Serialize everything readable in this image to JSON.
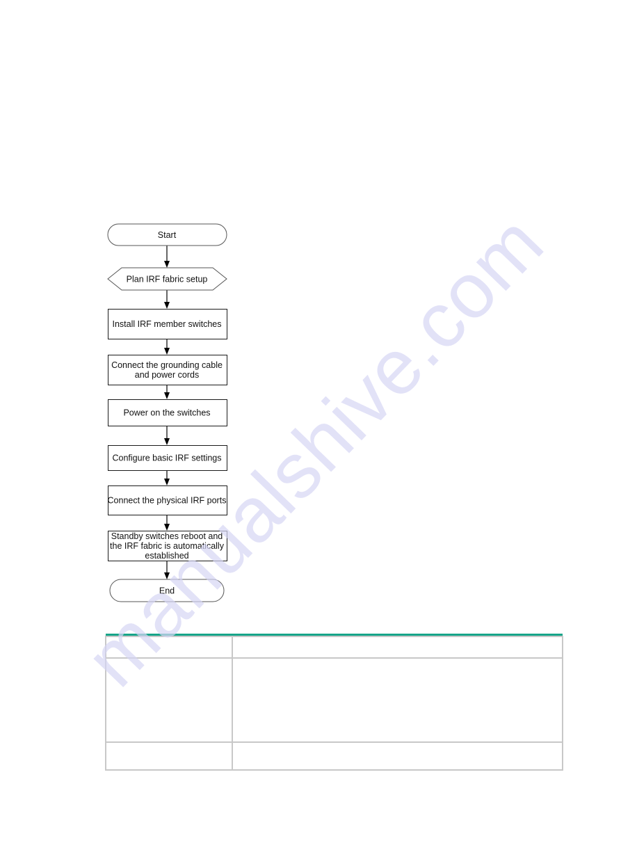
{
  "flowchart": {
    "steps": [
      {
        "id": "start",
        "shape": "terminal",
        "lines": [
          "Start"
        ]
      },
      {
        "id": "plan",
        "shape": "hexagon",
        "lines": [
          "Plan IRF fabric setup"
        ]
      },
      {
        "id": "install",
        "shape": "process",
        "lines": [
          "Install IRF member switches"
        ]
      },
      {
        "id": "ground",
        "shape": "process",
        "lines": [
          "Connect the grounding cable",
          "and power cords"
        ]
      },
      {
        "id": "power",
        "shape": "process",
        "lines": [
          "Power on the switches"
        ]
      },
      {
        "id": "configure",
        "shape": "process",
        "lines": [
          "Configure basic IRF settings"
        ]
      },
      {
        "id": "connect-ports",
        "shape": "process",
        "lines": [
          "Connect the physical IRF ports"
        ]
      },
      {
        "id": "standby",
        "shape": "process",
        "lines": [
          "Standby switches reboot and",
          "the IRF fabric is automatically",
          "established"
        ]
      },
      {
        "id": "end",
        "shape": "terminal",
        "lines": [
          "End"
        ]
      }
    ]
  },
  "table": {
    "accent_color": "#17A589",
    "border_color": "#C8C8C8",
    "rows": [
      [
        "",
        ""
      ],
      [
        "",
        ""
      ],
      [
        "",
        ""
      ]
    ]
  },
  "watermark": {
    "text": "manualshive.com",
    "color": "#D6D6F5"
  }
}
